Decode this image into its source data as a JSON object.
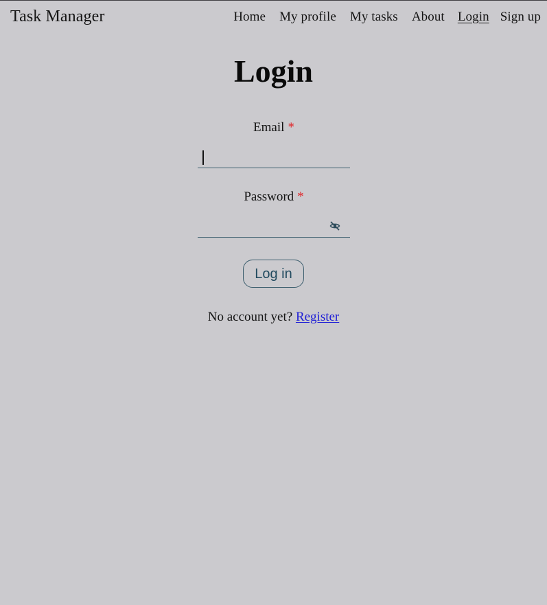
{
  "header": {
    "brand": "Task Manager",
    "nav": [
      {
        "label": "Home",
        "icon": null
      },
      {
        "label": "My profile"
      },
      {
        "label": "My tasks"
      },
      {
        "label": "About"
      },
      {
        "label": "Login",
        "active": true
      },
      {
        "label": "Sign up"
      }
    ]
  },
  "main": {
    "title": "Login",
    "email": {
      "label": "Email",
      "required_marker": "*",
      "value": "",
      "placeholder": ""
    },
    "password": {
      "label": "Password",
      "required_marker": "*",
      "value": "",
      "placeholder": "",
      "toggle_icon": "eye-off-icon"
    },
    "submit_label": "Log in",
    "register_prompt": "No account yet?",
    "register_link": "Register"
  },
  "colors": {
    "background": "#cbcace",
    "required": "#e0262a",
    "accent": "#3b5d6d",
    "link": "#1f1fd6"
  }
}
